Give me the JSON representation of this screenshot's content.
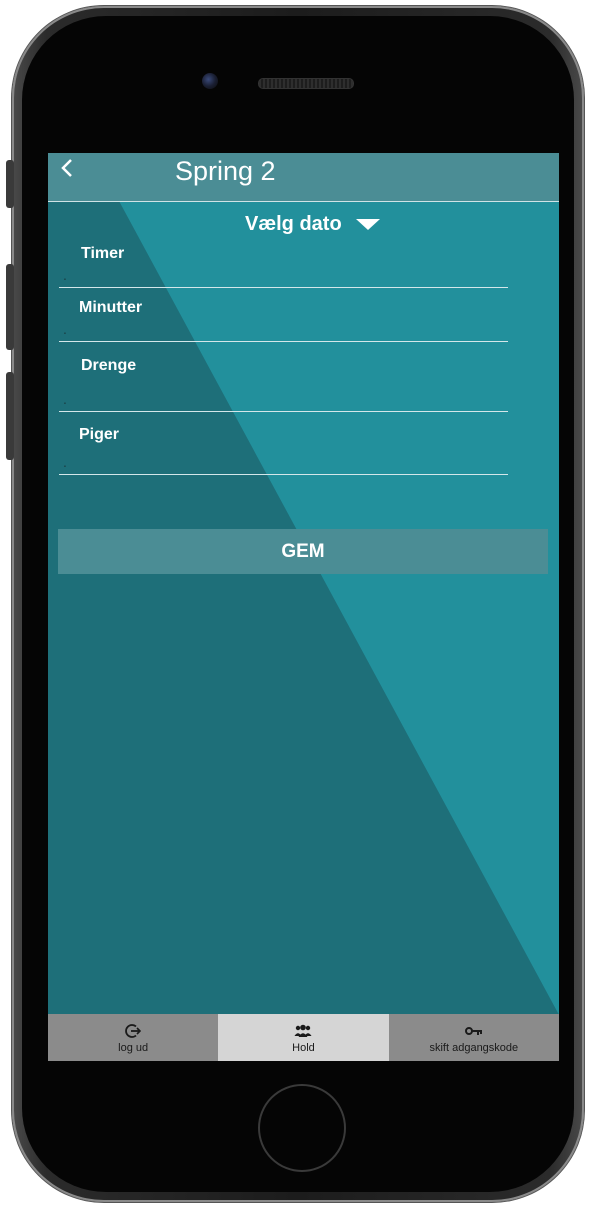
{
  "appbar": {
    "title": "Spring 2",
    "back_icon": "chevron-left-icon"
  },
  "date_picker": {
    "label": "Vælg dato",
    "icon": "caret-down-icon"
  },
  "fields": [
    {
      "label": "Timer",
      "value": "",
      "placeholder": "."
    },
    {
      "label": "Minutter",
      "value": "",
      "placeholder": "."
    },
    {
      "label": "Drenge",
      "value": "",
      "placeholder": "."
    },
    {
      "label": "Piger",
      "value": "",
      "placeholder": "."
    }
  ],
  "save_button": {
    "label": "GEM"
  },
  "bottom_nav": {
    "items": [
      {
        "label": "log ud",
        "icon": "logout-icon",
        "active": false
      },
      {
        "label": "Hold",
        "icon": "group-icon",
        "active": true
      },
      {
        "label": "skift adgangskode",
        "icon": "key-icon",
        "active": false
      }
    ]
  },
  "colors": {
    "appbar": "#4b8d95",
    "background_dark": "#1e6f79",
    "background_light": "#22909c",
    "nav_inactive": "#8b8b8b",
    "nav_active": "#d5d5d5"
  }
}
